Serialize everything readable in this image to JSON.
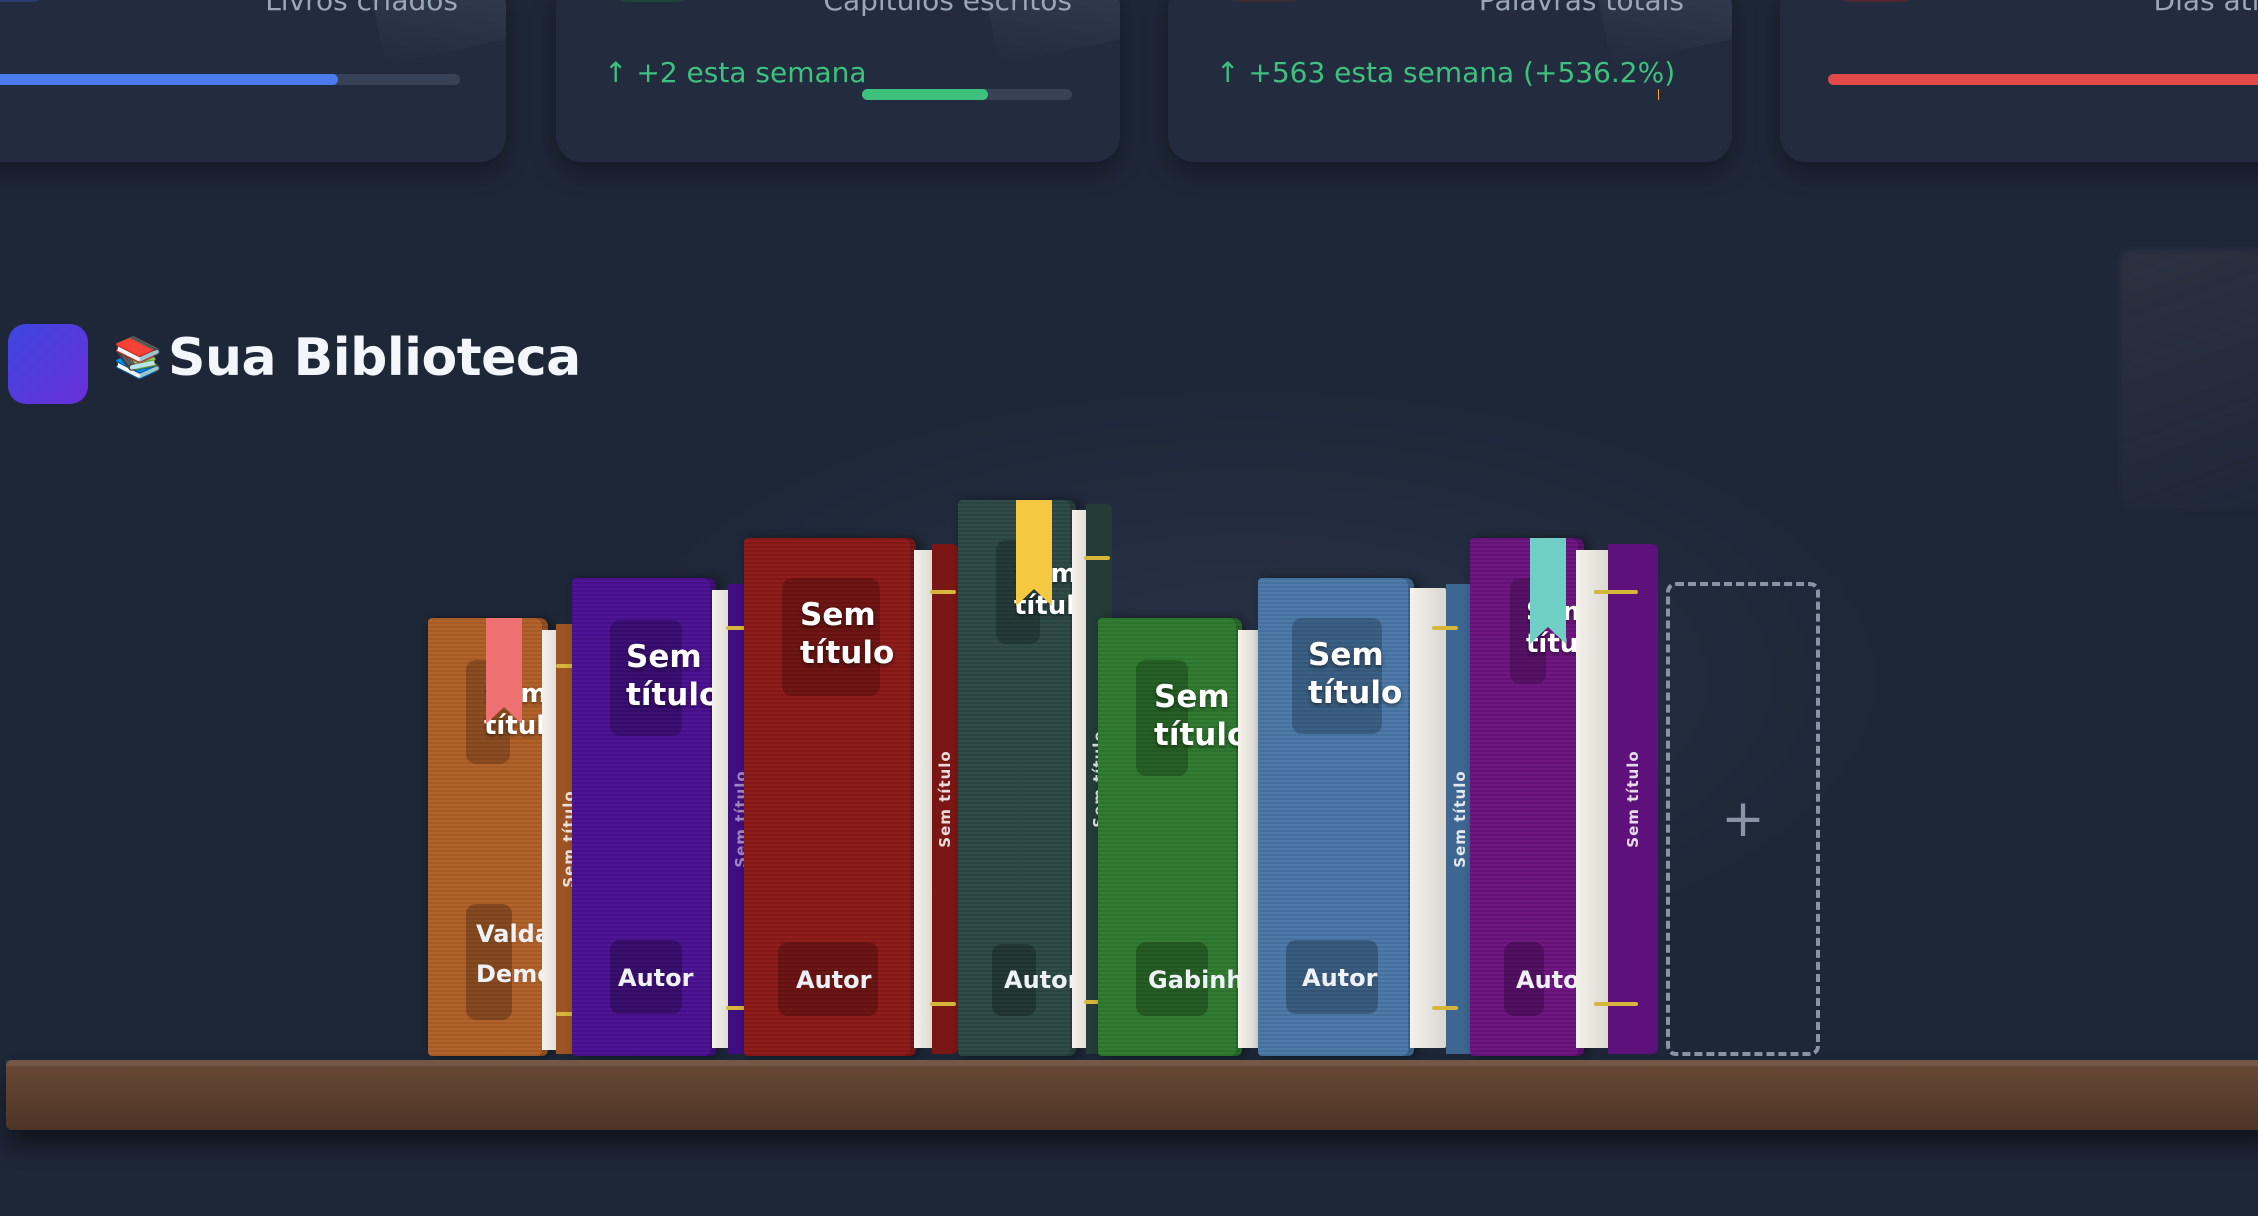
{
  "stats": [
    {
      "label": "Livros criados",
      "trend": "",
      "bar_percent": 75,
      "bar_color": "#4b7bec",
      "icon_color": "#2f3f7a"
    },
    {
      "label": "Capítulos escritos",
      "trend": "↑ +2 esta semana",
      "bar_percent": 60,
      "bar_color": "#3ec07f",
      "icon_color": "#1f4a3a"
    },
    {
      "label": "Palavras totais",
      "trend": "↑ +563 esta semana (+536.2%)",
      "bar_percent": 5,
      "bar_color": "#f2a93b",
      "icon_color": "#3f2f30"
    },
    {
      "label": "Dias ativ",
      "trend": "",
      "bar_percent": 100,
      "bar_color": "#e24a4a",
      "icon_color": "#5a2430"
    }
  ],
  "library": {
    "emoji": "📚",
    "title": "Sua Biblioteca",
    "add_label": "+"
  },
  "books": [
    {
      "title": "Sem\ntítulo",
      "spine": "Sem título",
      "author": "Valdai\nDeme",
      "color": "#b06028",
      "ribbon": "#ef7070"
    },
    {
      "title": "Sem\ntítulo",
      "spine": "Sem título",
      "author": "Autor",
      "color": "#4a1192",
      "ribbon": ""
    },
    {
      "title": "Sem\ntítulo",
      "spine": "Sem título",
      "author": "Autor",
      "color": "#8c1a18",
      "ribbon": ""
    },
    {
      "title": "Sem\ntítulo",
      "spine": "Sem título",
      "author": "Autor",
      "color": "#2c4844",
      "ribbon": "#f5c842"
    },
    {
      "title": "Sem\ntítulo",
      "spine": "",
      "author": "Gabinha",
      "color": "#2f7a2f",
      "ribbon": ""
    },
    {
      "title": "Sem\ntítulo",
      "spine": "Sem título",
      "author": "Autor",
      "color": "#4a78a8",
      "ribbon": ""
    },
    {
      "title": "Sem\ntítulo",
      "spine": "Sem título",
      "author": "Autor",
      "color": "#6c1480",
      "ribbon": "#6fcfc4"
    }
  ]
}
